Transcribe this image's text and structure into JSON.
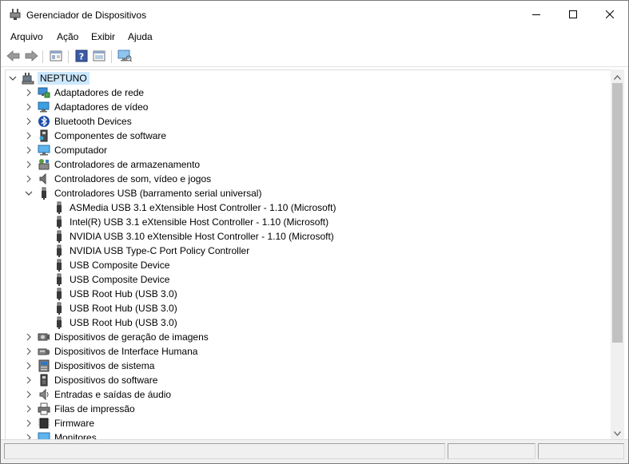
{
  "window": {
    "title": "Gerenciador de Dispositivos",
    "app_icon": "device-manager-icon"
  },
  "menu": {
    "items": [
      "Arquivo",
      "Ação",
      "Exibir",
      "Ajuda"
    ]
  },
  "toolbar": {
    "buttons": [
      "back-arrow-icon",
      "forward-arrow-icon",
      "properties-icon",
      "help-icon",
      "show-hidden-icon",
      "monitor-icon"
    ]
  },
  "tree": {
    "root": {
      "label": "NEPTUNO",
      "icon": "computer-icon",
      "expanded": true,
      "selected": true
    },
    "categories": [
      {
        "label": "Adaptadores de rede",
        "icon": "network-adapter-icon",
        "expanded": false
      },
      {
        "label": "Adaptadores de vídeo",
        "icon": "display-adapter-icon",
        "expanded": false
      },
      {
        "label": "Bluetooth Devices",
        "icon": "bluetooth-icon",
        "expanded": false
      },
      {
        "label": "Componentes de software",
        "icon": "software-component-icon",
        "expanded": false
      },
      {
        "label": "Computador",
        "icon": "computer-monitor-icon",
        "expanded": false
      },
      {
        "label": "Controladores de armazenamento",
        "icon": "storage-controller-icon",
        "expanded": false
      },
      {
        "label": "Controladores de som, vídeo e jogos",
        "icon": "speaker-icon",
        "expanded": false
      },
      {
        "label": "Controladores USB (barramento serial universal)",
        "icon": "usb-plug-icon",
        "expanded": true,
        "children": [
          "ASMedia USB 3.1 eXtensible Host Controller - 1.10 (Microsoft)",
          "Intel(R) USB 3.1 eXtensible Host Controller - 1.10 (Microsoft)",
          "NVIDIA USB 3.10 eXtensible Host Controller - 1.10 (Microsoft)",
          "NVIDIA USB Type-C Port Policy Controller",
          "USB Composite Device",
          "USB Composite Device",
          "USB Root Hub (USB 3.0)",
          "USB Root Hub (USB 3.0)",
          "USB Root Hub (USB 3.0)"
        ]
      },
      {
        "label": "Dispositivos de geração de imagens",
        "icon": "camera-icon",
        "expanded": false
      },
      {
        "label": "Dispositivos de Interface Humana",
        "icon": "hid-icon",
        "expanded": false
      },
      {
        "label": "Dispositivos de sistema",
        "icon": "system-device-icon",
        "expanded": false
      },
      {
        "label": "Dispositivos do software",
        "icon": "software-device-icon",
        "expanded": false
      },
      {
        "label": "Entradas e saídas de áudio",
        "icon": "audio-io-icon",
        "expanded": false
      },
      {
        "label": "Filas de impressão",
        "icon": "printer-icon",
        "expanded": false
      },
      {
        "label": "Firmware",
        "icon": "firmware-chip-icon",
        "expanded": false
      },
      {
        "label": "Monitores",
        "icon": "monitor-icon",
        "expanded": false
      }
    ]
  },
  "colors": {
    "selection": "#cce8ff",
    "scrollbar_thumb": "#c1c1c1"
  }
}
